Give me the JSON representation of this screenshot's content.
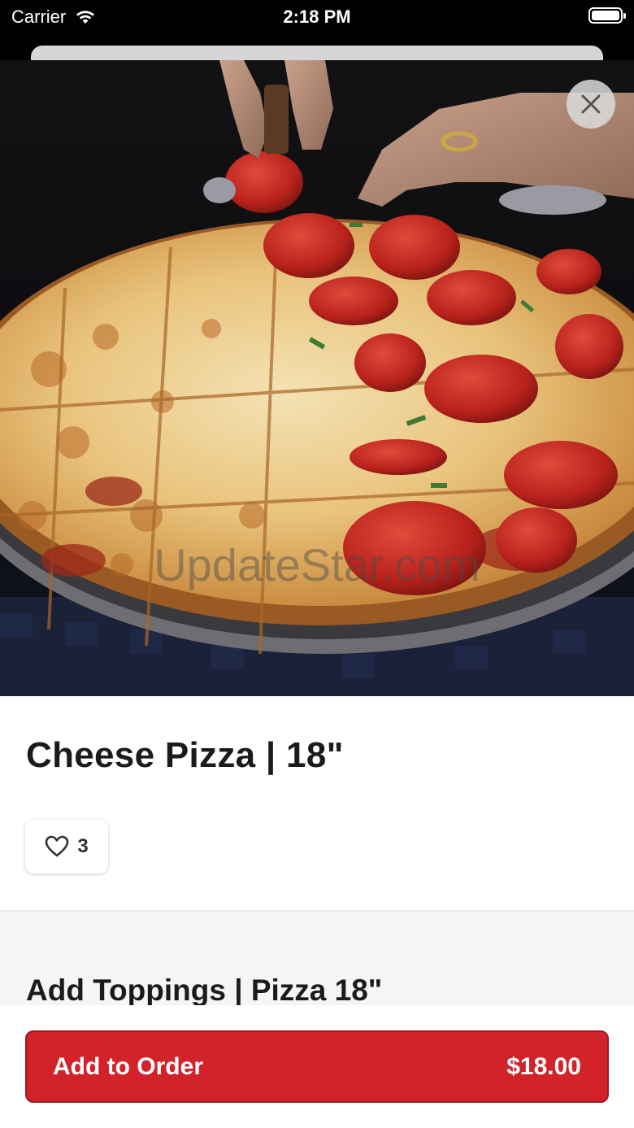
{
  "status_bar": {
    "carrier": "Carrier",
    "time": "2:18 PM"
  },
  "hero": {
    "watermark": "UpdateStar.com"
  },
  "product": {
    "title": "Cheese Pizza | 18\"",
    "likes": "3"
  },
  "toppings": {
    "title": "Add Toppings | Pizza 18\""
  },
  "order_button": {
    "label": "Add to Order",
    "price": "$18.00"
  },
  "colors": {
    "brand_red": "#d2232a"
  },
  "icons": {
    "close": "close-icon",
    "like": "heart-icon",
    "wifi": "wifi-icon",
    "battery": "battery-icon"
  }
}
